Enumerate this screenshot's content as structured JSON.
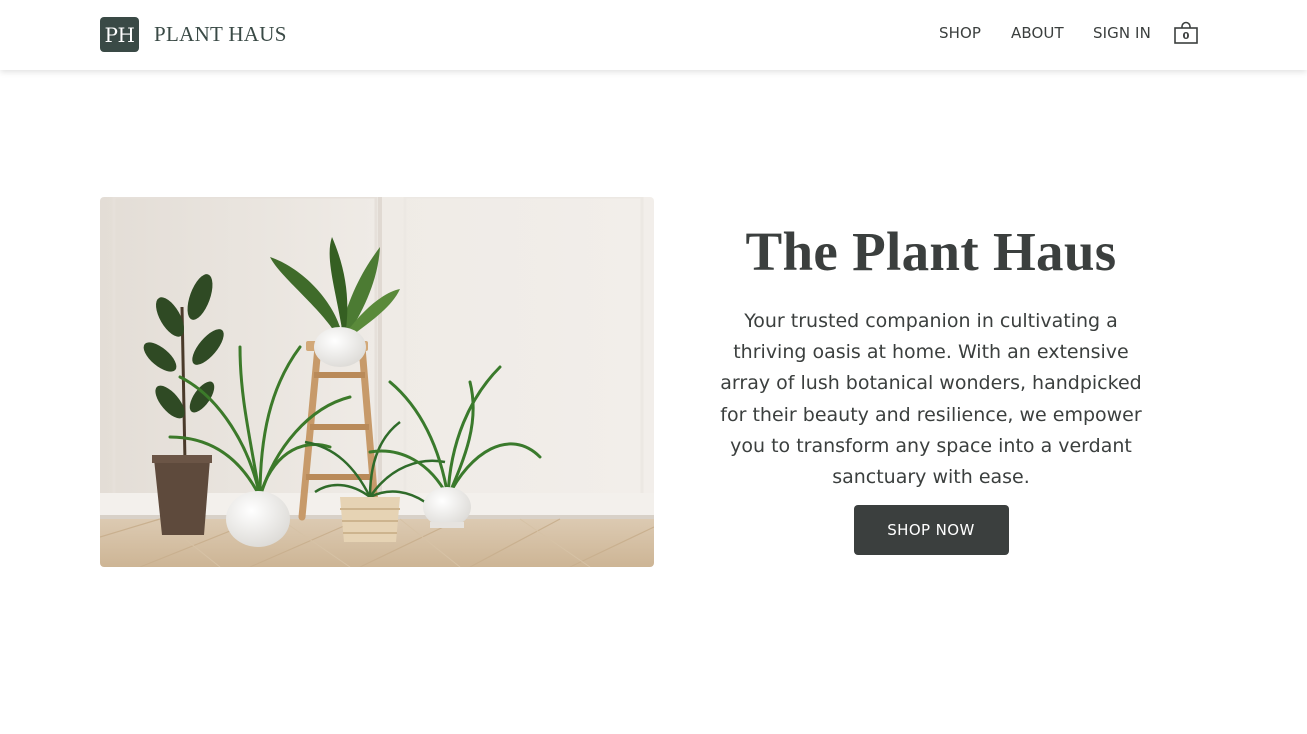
{
  "brand": {
    "badge": "PH",
    "name": "PLANT HAUS",
    "badge_color": "#3a4a46"
  },
  "nav": {
    "shop": "SHOP",
    "about": "ABOUT",
    "sign_in": "SIGN IN",
    "cart_icon": "shopping-bag-icon",
    "cart_count": "0"
  },
  "hero": {
    "image": "potted-plants-photo",
    "title": "The Plant Haus",
    "description": "Your trusted companion in cultivating a thriving oasis at home. With an extensive array of lush botanical wonders, handpicked for their beauty and resilience, we empower you to transform any space into a verdant sanctuary with ease.",
    "cta": "SHOP NOW",
    "cta_color": "#3b3f3e"
  },
  "colors": {
    "text": "#3b3f3e",
    "background": "#ffffff"
  }
}
